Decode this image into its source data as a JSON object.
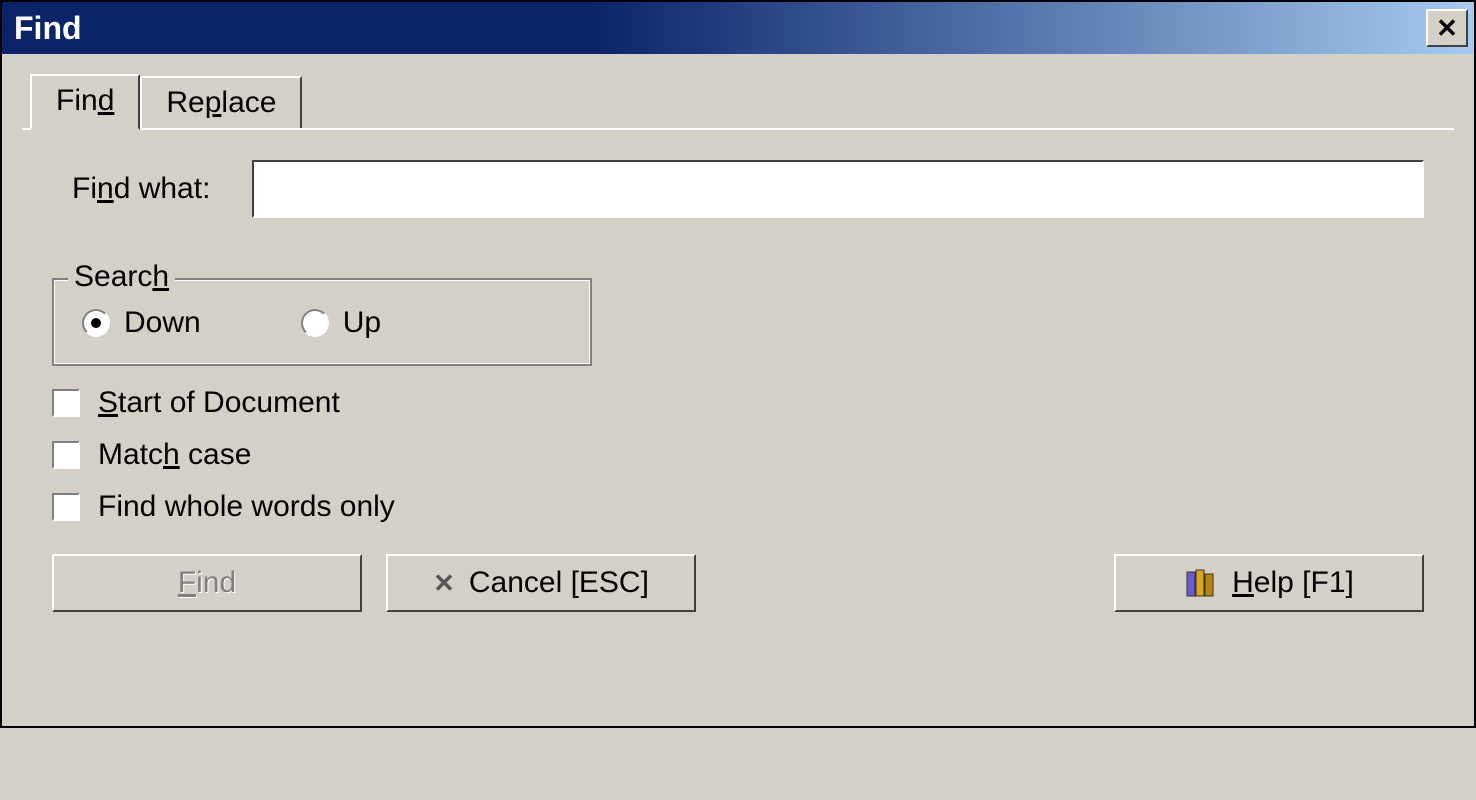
{
  "titlebar": {
    "title": "Find"
  },
  "tabs": {
    "find": "Find",
    "replace": "Replace",
    "active": "find"
  },
  "find": {
    "label_prefix": "Fi",
    "label_uchar": "n",
    "label_suffix": "d what:",
    "value": ""
  },
  "search_group": {
    "legend_prefix": "Searc",
    "legend_uchar": "h",
    "down": "Down",
    "up": "Up",
    "selected": "down"
  },
  "checks": {
    "start_prefix": "",
    "start_uchar": "S",
    "start_suffix": "tart of Document",
    "match_prefix": "Matc",
    "match_uchar": "h",
    "match_suffix": " case",
    "whole": "Find whole words only"
  },
  "buttons": {
    "find_prefix": "",
    "find_uchar": "F",
    "find_suffix": "ind",
    "cancel": "Cancel [ESC]",
    "help_prefix": "",
    "help_uchar": "H",
    "help_suffix": "elp [F1]"
  }
}
